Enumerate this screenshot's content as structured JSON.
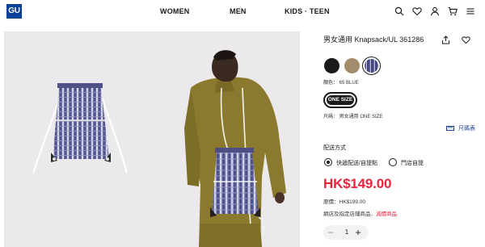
{
  "header": {
    "logo": "GU",
    "nav": [
      "WOMEN",
      "MEN",
      "KIDS · TEEN"
    ],
    "icons": [
      "search-icon",
      "heart-icon",
      "user-icon",
      "cart-icon",
      "menu-icon"
    ]
  },
  "gallery": {
    "images": [
      "product-image-bag",
      "product-image-model"
    ]
  },
  "product": {
    "title": "男女通用 Knapsack/UL 361286",
    "colors": [
      {
        "name": "black",
        "hex": "#1a1a1a"
      },
      {
        "name": "beige",
        "hex": "#a38c6c"
      },
      {
        "name": "blue",
        "hex": "#4a4c85"
      }
    ],
    "color_label": "顏色： 65 BLUE",
    "size_option": "ONE SIZE",
    "size_label": "尺碼： 男女通用 ONE SIZE",
    "size_chart": "尺碼表",
    "shipping_heading": "配送方式",
    "shipping_options": [
      "快遞配送/自提點",
      "門店自提"
    ],
    "price": "HK$149.00",
    "original_price": "原價：HK$199.00",
    "note_prefix": "網店及指定店鋪商品．",
    "note_highlight": "減價商品",
    "quantity": "1",
    "qty_minus": "−",
    "qty_plus": "+"
  },
  "colors": {
    "accent_red": "#e8253b",
    "logo_blue": "#0b3f9c"
  }
}
